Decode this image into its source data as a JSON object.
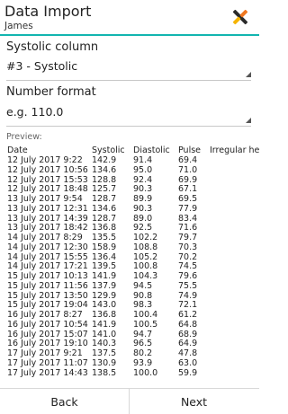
{
  "header": {
    "title": "Data Import",
    "subtitle": "James",
    "icon": "import-app-icon"
  },
  "systolic": {
    "label": "Systolic column",
    "value": "#3 - Systolic"
  },
  "number_format": {
    "label": "Number format",
    "value": "e.g. 110.0"
  },
  "preview": {
    "label": "Preview:",
    "columns": [
      "Date",
      "Systolic",
      "Diastolic",
      "Pulse",
      "Irregular hea"
    ],
    "rows": [
      [
        "12 July 2017 9:22",
        "142.9",
        "91.4",
        "69.4"
      ],
      [
        "12 July 2017 10:56",
        "134.6",
        "95.0",
        "71.0"
      ],
      [
        "12 July 2017 15:53",
        "128.8",
        "92.4",
        "69.9"
      ],
      [
        "12 July 2017 18:48",
        "125.7",
        "90.3",
        "67.1"
      ],
      [
        "13 July 2017 9:54",
        "128.7",
        "89.9",
        "69.5"
      ],
      [
        "13 July 2017 12:31",
        "134.6",
        "90.3",
        "77.9"
      ],
      [
        "13 July 2017 14:39",
        "128.7",
        "89.0",
        "83.4"
      ],
      [
        "13 July 2017 18:42",
        "136.8",
        "92.5",
        "71.6"
      ],
      [
        "14 July 2017 8:29",
        "135.5",
        "102.2",
        "79.7"
      ],
      [
        "14 July 2017 12:30",
        "158.9",
        "108.8",
        "70.3"
      ],
      [
        "14 July 2017 15:55",
        "136.4",
        "105.2",
        "70.2"
      ],
      [
        "14 July 2017 17:21",
        "139.5",
        "100.8",
        "74.5"
      ],
      [
        "15 July 2017 10:13",
        "141.9",
        "104.3",
        "79.6"
      ],
      [
        "15 July 2017 11:56",
        "137.9",
        "94.5",
        "75.5"
      ],
      [
        "15 July 2017 13:50",
        "129.9",
        "90.8",
        "74.9"
      ],
      [
        "15 July 2017 19:04",
        "143.0",
        "98.3",
        "72.1"
      ],
      [
        "16 July 2017 8:27",
        "136.8",
        "100.4",
        "61.2"
      ],
      [
        "16 July 2017 10:54",
        "141.9",
        "100.5",
        "64.8"
      ],
      [
        "16 July 2017 15:07",
        "141.0",
        "94.7",
        "68.9"
      ],
      [
        "16 July 2017 19:10",
        "140.3",
        "96.5",
        "64.9"
      ],
      [
        "17 July 2017 9:21",
        "137.5",
        "80.2",
        "47.8"
      ],
      [
        "17 July 2017 11:07",
        "130.9",
        "93.9",
        "63.0"
      ],
      [
        "17 July 2017 14:43",
        "138.5",
        "100.0",
        "59.9"
      ]
    ]
  },
  "footer": {
    "back_label": "Back",
    "next_label": "Next"
  }
}
